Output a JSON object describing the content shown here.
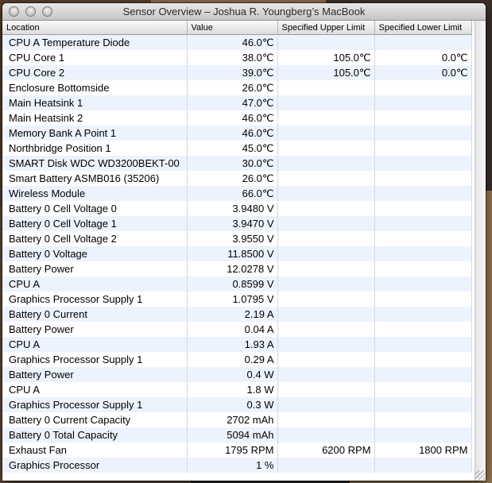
{
  "window": {
    "title": "Sensor Overview – Joshua R. Youngberg’s MacBook"
  },
  "table": {
    "columns": [
      "Location",
      "Value",
      "Specified Upper Limit",
      "Specified Lower Limit"
    ],
    "rows": [
      {
        "location": "CPU A Temperature Diode",
        "value": "46.0℃",
        "upper": "",
        "lower": ""
      },
      {
        "location": "CPU Core 1",
        "value": "38.0℃",
        "upper": "105.0℃",
        "lower": "0.0℃"
      },
      {
        "location": "CPU Core 2",
        "value": "39.0℃",
        "upper": "105.0℃",
        "lower": "0.0℃"
      },
      {
        "location": "Enclosure Bottomside",
        "value": "26.0℃",
        "upper": "",
        "lower": ""
      },
      {
        "location": "Main Heatsink 1",
        "value": "47.0℃",
        "upper": "",
        "lower": ""
      },
      {
        "location": "Main Heatsink 2",
        "value": "46.0℃",
        "upper": "",
        "lower": ""
      },
      {
        "location": "Memory Bank A Point 1",
        "value": "46.0℃",
        "upper": "",
        "lower": ""
      },
      {
        "location": "Northbridge Position 1",
        "value": "45.0℃",
        "upper": "",
        "lower": ""
      },
      {
        "location": "SMART Disk WDC WD3200BEKT-00",
        "value": "30.0℃",
        "upper": "",
        "lower": ""
      },
      {
        "location": "Smart Battery ASMB016 (35206)",
        "value": "26.0℃",
        "upper": "",
        "lower": ""
      },
      {
        "location": "Wireless Module",
        "value": "66.0℃",
        "upper": "",
        "lower": ""
      },
      {
        "location": "Battery 0 Cell Voltage 0",
        "value": "3.9480 V",
        "upper": "",
        "lower": ""
      },
      {
        "location": "Battery 0 Cell Voltage 1",
        "value": "3.9470 V",
        "upper": "",
        "lower": ""
      },
      {
        "location": "Battery 0 Cell Voltage 2",
        "value": "3.9550 V",
        "upper": "",
        "lower": ""
      },
      {
        "location": "Battery 0 Voltage",
        "value": "11.8500 V",
        "upper": "",
        "lower": ""
      },
      {
        "location": "Battery Power",
        "value": "12.0278 V",
        "upper": "",
        "lower": ""
      },
      {
        "location": "CPU A",
        "value": "0.8599 V",
        "upper": "",
        "lower": ""
      },
      {
        "location": "Graphics Processor Supply 1",
        "value": "1.0795 V",
        "upper": "",
        "lower": ""
      },
      {
        "location": "Battery 0 Current",
        "value": "2.19 A",
        "upper": "",
        "lower": ""
      },
      {
        "location": "Battery Power",
        "value": "0.04 A",
        "upper": "",
        "lower": ""
      },
      {
        "location": "CPU A",
        "value": "1.93 A",
        "upper": "",
        "lower": ""
      },
      {
        "location": "Graphics Processor Supply 1",
        "value": "0.29 A",
        "upper": "",
        "lower": ""
      },
      {
        "location": "Battery Power",
        "value": "0.4 W",
        "upper": "",
        "lower": ""
      },
      {
        "location": "CPU A",
        "value": "1.8 W",
        "upper": "",
        "lower": ""
      },
      {
        "location": "Graphics Processor Supply 1",
        "value": "0.3 W",
        "upper": "",
        "lower": ""
      },
      {
        "location": "Battery 0 Current Capacity",
        "value": "2702 mAh",
        "upper": "",
        "lower": ""
      },
      {
        "location": "Battery 0 Total Capacity",
        "value": "5094 mAh",
        "upper": "",
        "lower": ""
      },
      {
        "location": "Exhaust Fan",
        "value": "1795 RPM",
        "upper": "6200 RPM",
        "lower": "1800 RPM"
      },
      {
        "location": "Graphics Processor",
        "value": "1 %",
        "upper": "",
        "lower": ""
      }
    ]
  },
  "colors": {
    "stripe": "#edf3fe",
    "background": "#ffffff"
  }
}
